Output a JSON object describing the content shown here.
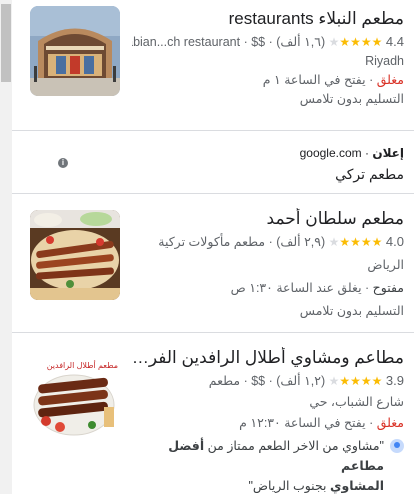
{
  "results": [
    {
      "title": "مطعم النبلاء restaurants",
      "rating": "4.4",
      "stars_filled": 4,
      "reviews": "(١,٦ ألف)",
      "price": "$$",
      "category": "Saudi Arabian...ch restaurant",
      "location": "Riyadh",
      "status": "مغلق",
      "hours": "يفتح في الساعة ١ م",
      "delivery": "التسليم بدون تلامس"
    },
    {
      "title": "مطعم سلطان أحمد",
      "rating": "4.0",
      "stars_filled": 4,
      "reviews": "(٢,٩ ألف)",
      "category": "مطعم مأكولات تركية",
      "location": "الرياض",
      "status": "مفتوح",
      "hours": "يغلق عند الساعة ١:٣٠ ص",
      "delivery": "التسليم بدون تلامس"
    },
    {
      "title": "مطاعم ومشاوي أطلال الرافدين الفرع الرئ...",
      "rating": "3.9",
      "stars_filled": 4,
      "reviews": "(١,٢ ألف)",
      "price": "$$",
      "category": "مطعم",
      "location": "شارع الشباب، حي",
      "status": "مغلق",
      "hours": "يفتح في الساعة ١٢:٣٠ م",
      "review_quote": "\"مشاوي من الاخر الطعم ممتاز من",
      "review_bold_1": "أفضل مطاعم",
      "review_bold_2": "المشاوي",
      "review_end": "بجنوب الرياض\"",
      "image_text": "مطعم أطلال الرافدين"
    }
  ],
  "ad": {
    "label": "إعلان",
    "source": "google.com",
    "title": "مطعم تركي",
    "info_glyph": "i"
  },
  "colors": {
    "star": "#fbbc04",
    "closed": "#d93025",
    "open": "#188038"
  }
}
